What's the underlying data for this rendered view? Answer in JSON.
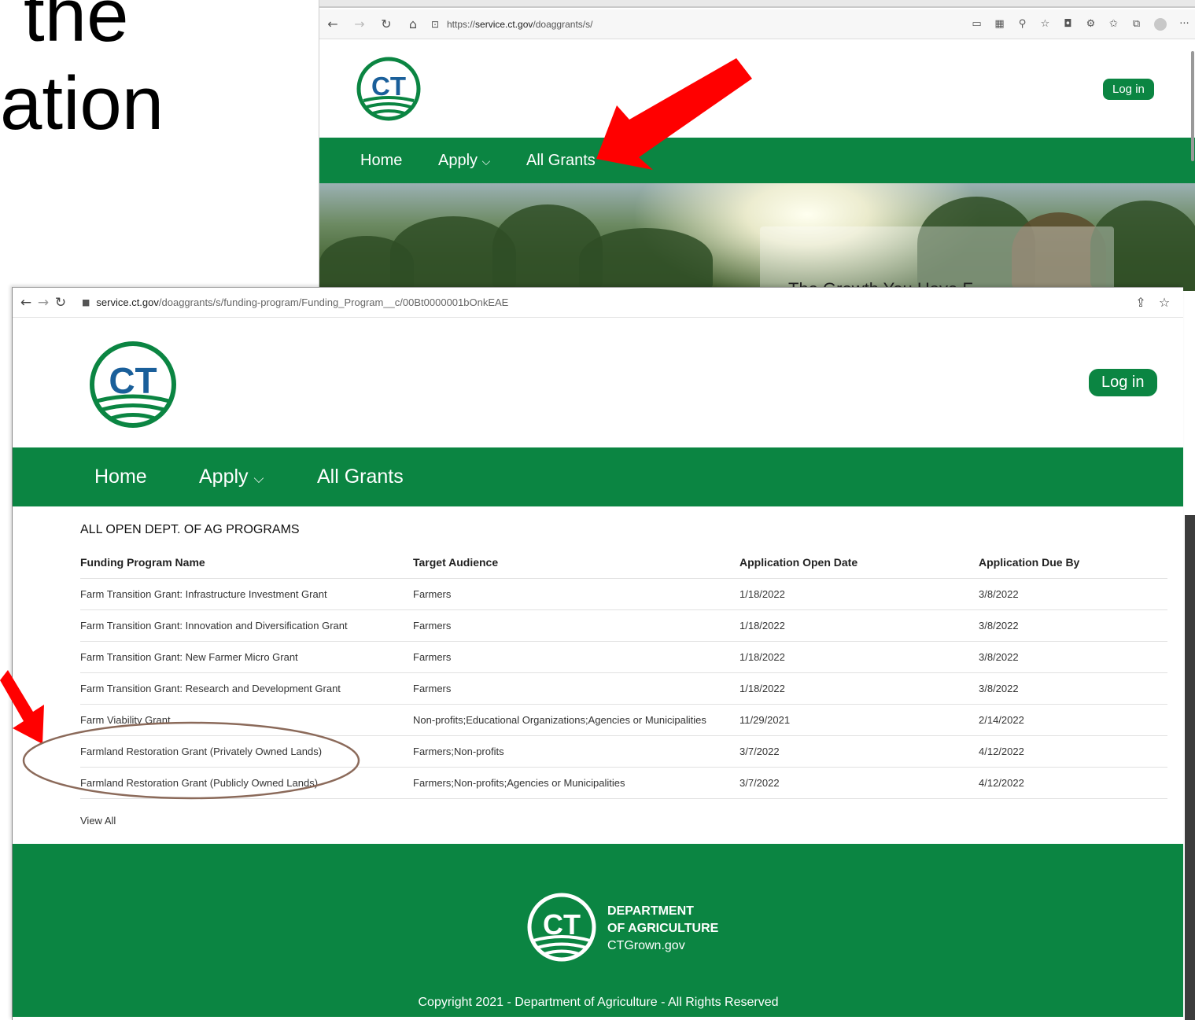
{
  "slide": {
    "line1": "the",
    "line2": "ation"
  },
  "back_browser": {
    "url_prefix": "https://",
    "url_host": "service.ct.gov",
    "url_path": "/doaggrants/s/",
    "logo_text": "CT",
    "login_label": "Log in",
    "nav": {
      "home": "Home",
      "apply": "Apply",
      "apply_chevron": "⌵",
      "all_grants": "All Grants"
    },
    "hero_text": "The Growth You Have F"
  },
  "front_browser": {
    "url_host": "service.ct.gov",
    "url_path": "/doaggrants/s/funding-program/Funding_Program__c/00Bt0000001bOnkEAE",
    "logo_text": "CT",
    "login_label": "Log in",
    "nav": {
      "home": "Home",
      "apply": "Apply",
      "apply_chevron": "⌵",
      "all_grants": "All Grants"
    },
    "programs_title": "ALL OPEN DEPT. OF AG PROGRAMS",
    "table": {
      "headers": [
        "Funding Program Name",
        "Target Audience",
        "Application Open Date",
        "Application Due By"
      ],
      "rows": [
        [
          "Farm Transition Grant: Infrastructure Investment Grant",
          "Farmers",
          "1/18/2022",
          "3/8/2022"
        ],
        [
          "Farm Transition Grant: Innovation and Diversification Grant",
          "Farmers",
          "1/18/2022",
          "3/8/2022"
        ],
        [
          "Farm Transition Grant: New Farmer Micro Grant",
          "Farmers",
          "1/18/2022",
          "3/8/2022"
        ],
        [
          "Farm Transition Grant: Research and Development Grant",
          "Farmers",
          "1/18/2022",
          "3/8/2022"
        ],
        [
          "Farm Viability Grant",
          "Non-profits;Educational Organizations;Agencies or Municipalities",
          "11/29/2021",
          "2/14/2022"
        ],
        [
          "Farmland Restoration Grant (Privately Owned Lands)",
          "Farmers;Non-profits",
          "3/7/2022",
          "4/12/2022"
        ],
        [
          "Farmland Restoration Grant (Publicly Owned Lands)",
          "Farmers;Non-profits;Agencies or Municipalities",
          "3/7/2022",
          "4/12/2022"
        ]
      ]
    },
    "view_all": "View All",
    "footer": {
      "logo_text": "CT",
      "dept_line1": "DEPARTMENT",
      "dept_line2": "OF AGRICULTURE",
      "site": "CTGrown.gov",
      "copyright": "Copyright 2021 - Department of Agriculture - All Rights Reserved"
    }
  },
  "icons": {
    "back": "←",
    "forward": "→",
    "reload": "C",
    "home": "⌂",
    "lock": "🔒",
    "share": "⇪",
    "star": "☆",
    "more": "···"
  },
  "colors": {
    "brand_green": "#0b8542",
    "annotation_red": "#ff0000",
    "circle_brown": "#8b6a5a"
  }
}
